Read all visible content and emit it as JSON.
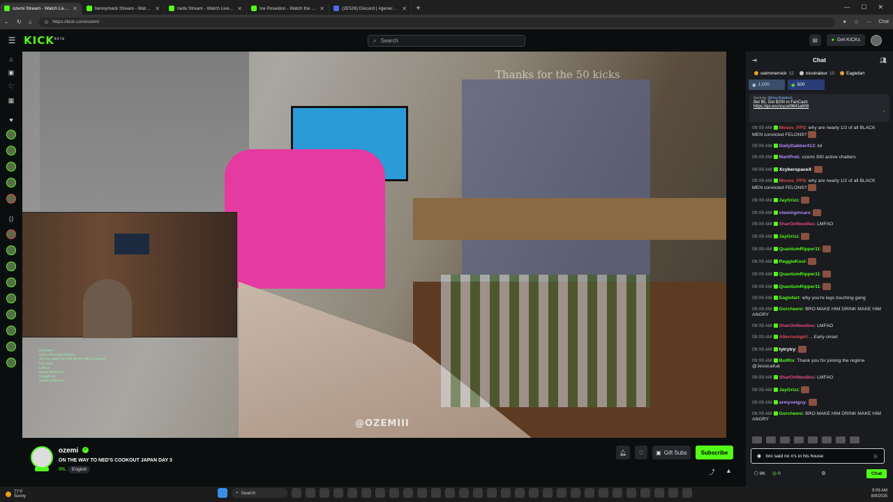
{
  "browser": {
    "tabs": [
      {
        "title": "ozemi Stream - Watch Live on Kick",
        "active": true,
        "icon": "kick"
      },
      {
        "title": "bennymack Stream - Watch Live on Kick",
        "active": false,
        "icon": "kick"
      },
      {
        "title": "nedx Stream - Watch Live on Kick",
        "active": false,
        "icon": "kick"
      },
      {
        "title": "Ice Poseidon - Watch the VOD on Kick",
        "active": false,
        "icon": "kick"
      },
      {
        "title": "(2E526) Discord | #general | Pu...",
        "active": false,
        "icon": "discord"
      }
    ],
    "url": "https://kick.com/ozemi",
    "chat_button": "Chat"
  },
  "kick": {
    "logo": "KICK",
    "logo_sup": "BETA",
    "search_placeholder": "Search",
    "get_kicks": "Get KICKs"
  },
  "video": {
    "overlay_text": "Thanks for the 50 kicks",
    "watermark": "@OZEMIII",
    "overlay_chat": [
      "FELONS?",
      "ozemi 300 active chatters",
      "why are nearly 1/2 of all BLACK MEN convicted",
      "FELONS?",
      "LMFAO",
      "QuantumRipper11",
      "ReggieKool",
      "QuantumRipper11"
    ]
  },
  "stream": {
    "name": "ozemi",
    "title": "ON THE WAY TO NED'S COOKOUT JAPAN DAY 3",
    "category": "IRL",
    "language": "English",
    "gift_subs": "Gift Subs",
    "subscribe": "Subscribe",
    "live_badge": "LIVE"
  },
  "chat": {
    "header": "Chat",
    "top_gifters": [
      {
        "name": "swimmernick",
        "count": "12"
      },
      {
        "name": "nicoinabox",
        "count": "10"
      },
      {
        "name": "Eaglefart",
        "count": ""
      }
    ],
    "goals": [
      "1,000",
      "500"
    ],
    "pinned": {
      "sent_by": "Sent by",
      "sender": "@HeySidekick",
      "line1": "Bet $5, Get $200 in FanCash",
      "link": "https://go.escncy.io/9841a608"
    },
    "messages": [
      {
        "time": "09:09 AM",
        "user": "Moses_FPS",
        "color": "#e44b4b",
        "text": "why are nearly 1/2 of all BLACK MEN convicted FELONS?",
        "emote": true
      },
      {
        "time": "09:09 AM",
        "user": "DailyDabber413",
        "color": "#b48cff",
        "text": "lol",
        "emote": false
      },
      {
        "time": "09:09 AM",
        "user": "MartPrek",
        "color": "#b48cff",
        "text": "ozemi 300 active chatters",
        "emote": false
      },
      {
        "time": "09:09 AM",
        "user": "XcyberspaceX",
        "color": "#ffffff",
        "text": "",
        "emote": true
      },
      {
        "time": "09:09 AM",
        "user": "Moses_FPS",
        "color": "#e44b4b",
        "text": "why are nearly 1/2 of all BLACK MEN convicted FELONS?",
        "emote": true
      },
      {
        "time": "09:09 AM",
        "user": "JayGrizz",
        "color": "#53fc18",
        "text": "",
        "emote": true
      },
      {
        "time": "09:09 AM",
        "user": "viewingincars",
        "color": "#b48cff",
        "text": "",
        "emote": true
      },
      {
        "time": "09:09 AM",
        "user": "SharOnNeedles",
        "color": "#e44b7a",
        "text": "LMFAO",
        "emote": false
      },
      {
        "time": "09:09 AM",
        "user": "JayGrizz",
        "color": "#53fc18",
        "text": "",
        "emote": true
      },
      {
        "time": "09:09 AM",
        "user": "QuantumRipper11",
        "color": "#53fc18",
        "text": "",
        "emote": true
      },
      {
        "time": "09:09 AM",
        "user": "ReggieKool",
        "color": "#53fc18",
        "text": "",
        "emote": true
      },
      {
        "time": "09:09 AM",
        "user": "QuantumRipper11",
        "color": "#53fc18",
        "text": "",
        "emote": true
      },
      {
        "time": "09:09 AM",
        "user": "QuantumRipper11",
        "color": "#53fc18",
        "text": "",
        "emote": true
      },
      {
        "time": "09:09 AM",
        "user": "Eaglefart",
        "color": "#53fc18",
        "text": "why you're legs touching gang",
        "emote": false
      },
      {
        "time": "09:09 AM",
        "user": "Gorcheeni",
        "color": "#53fc18",
        "text": "BRO MAKE HIM DRINK MAKE HIM ANGRY",
        "emote": false
      },
      {
        "time": "09:09 AM",
        "user": "SharOnNeedles",
        "color": "#e44b7a",
        "text": "LMFAO",
        "emote": false
      },
      {
        "time": "09:09 AM",
        "user": "Alterrockgirl",
        "color": "#e44b4b",
        "text": "...Early onset",
        "emote": false
      },
      {
        "time": "09:09 AM",
        "user": "tytrytry",
        "color": "#ffffff",
        "text": "",
        "emote": true
      },
      {
        "time": "09:09 AM",
        "user": "BotRix",
        "color": "#53fc18",
        "text": "Thank you for joining the regime @JessicaKat",
        "emote": false
      },
      {
        "time": "09:09 AM",
        "user": "SharOnNeedles",
        "color": "#e44b7a",
        "text": "LMFAO",
        "emote": false
      },
      {
        "time": "09:09 AM",
        "user": "JayGrizz",
        "color": "#53fc18",
        "text": "",
        "emote": true
      },
      {
        "time": "09:09 AM",
        "user": "armyvetguy",
        "color": "#b48cff",
        "text": "",
        "emote": true
      },
      {
        "time": "09:09 AM",
        "user": "Gorcheeni",
        "color": "#53fc18",
        "text": "BRO MAKE HIM DRINK MAKE HIM ANGRY",
        "emote": false
      }
    ],
    "input_value": "bro said no n's in his house",
    "kicks_count": "8K",
    "points": "0",
    "send_label": "Chat"
  },
  "taskbar": {
    "temp": "77°F",
    "weather": "Sunny",
    "search": "Search",
    "time": "9:09 AM",
    "date": "8/9/2025"
  },
  "colors": {
    "kick_green": "#53fc18",
    "bg": "#0b0e0f",
    "panel": "#191b1f"
  }
}
